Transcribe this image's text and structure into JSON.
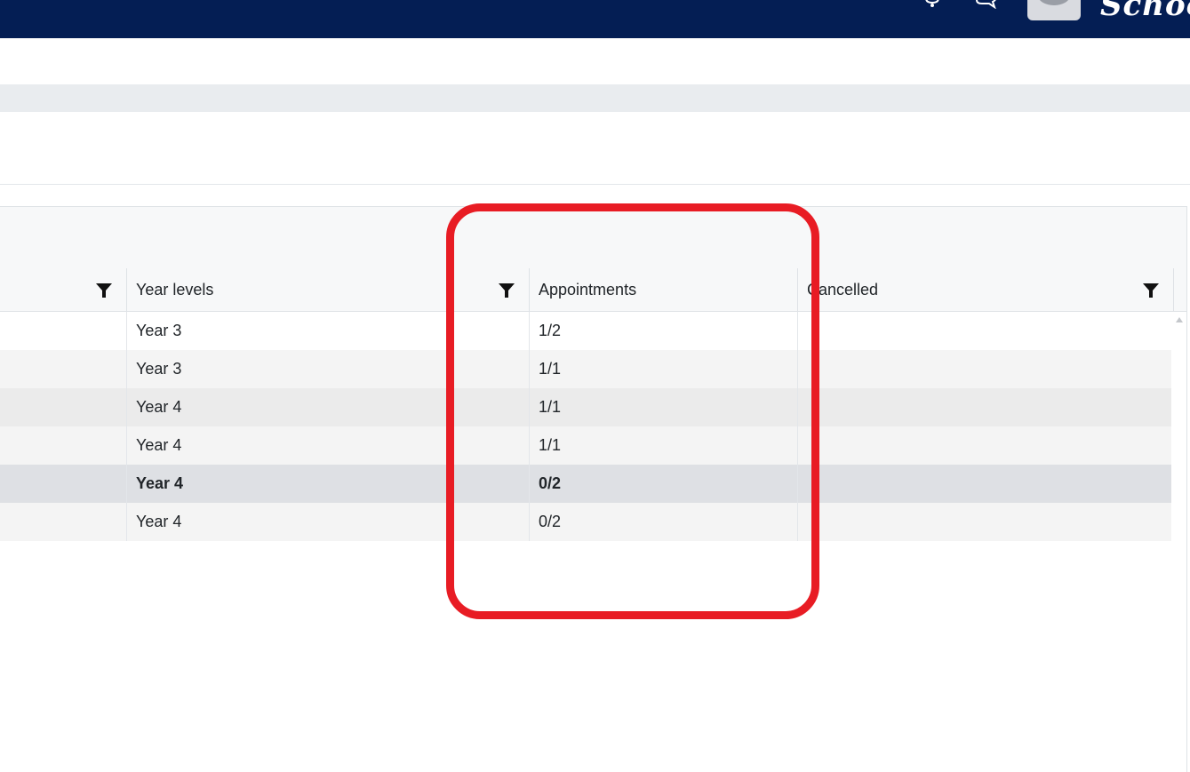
{
  "topbar": {
    "brand_text": "School",
    "icons": [
      "bell-icon",
      "chat-icon",
      "avatar-icon"
    ],
    "background": "#041e54"
  },
  "grid": {
    "columns": [
      {
        "label": "",
        "filterable": true
      },
      {
        "label": "Year levels",
        "filterable": true
      },
      {
        "label": "Appointments",
        "filterable": false
      },
      {
        "label": "Cancelled",
        "filterable": true
      }
    ],
    "rows": [
      {
        "year_level": "Year 3",
        "appointments": "1/2",
        "cancelled": "",
        "bold": false,
        "background": "#ffffff"
      },
      {
        "year_level": "Year 3",
        "appointments": "1/1",
        "cancelled": "",
        "bold": false,
        "background": "#f4f4f4"
      },
      {
        "year_level": "Year 4",
        "appointments": "1/1",
        "cancelled": "",
        "bold": false,
        "background": "#ebebeb"
      },
      {
        "year_level": "Year 4",
        "appointments": "1/1",
        "cancelled": "",
        "bold": false,
        "background": "#f4f4f4"
      },
      {
        "year_level": "Year 4",
        "appointments": "0/2",
        "cancelled": "",
        "bold": true,
        "background": "#dee0e4"
      },
      {
        "year_level": "Year 4",
        "appointments": "0/2",
        "cancelled": "",
        "bold": false,
        "background": "#f4f4f4"
      }
    ]
  },
  "annotation": {
    "color": "#e81c24",
    "target": "Appointments column"
  }
}
